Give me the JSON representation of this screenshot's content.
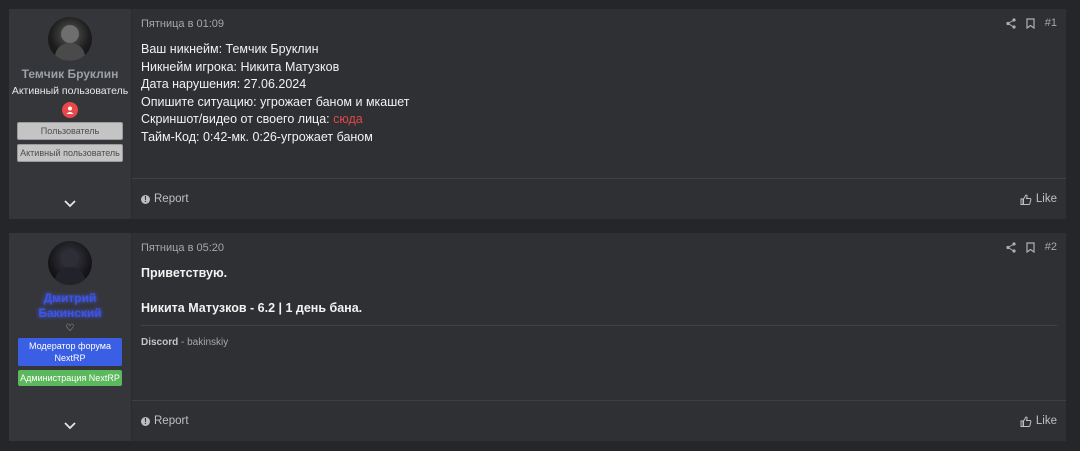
{
  "posts": [
    {
      "user": {
        "name": "Темчик Бруклин",
        "title": "Активный пользователь",
        "banners": [
          "Пользователь",
          "Активный пользователь"
        ],
        "trophy_icon": "user-status-icon"
      },
      "date": "Пятница в 01:09",
      "number": "#1",
      "lines": [
        "Ваш никнейм: Темчик Бруклин",
        "Никнейм игрока: Никита Матузков",
        "Дата нарушения: 27.06.2024",
        "Опишите ситуацию: угрожает баном и мкашет"
      ],
      "screenshot_label": "Скриншот/видео от своего лица: ",
      "screenshot_link": "сюда",
      "last_line": "Тайм-Код: 0:42-мк. 0:26-угрожает баном",
      "report_label": "Report",
      "like_label": "Like"
    },
    {
      "user": {
        "name": "Дмитрий Бакинский",
        "heart": "♡",
        "banners": [
          "Модератор форума NextRP",
          "Администрация NextRP"
        ]
      },
      "date": "Пятница в 05:20",
      "number": "#2",
      "greeting": "Приветствую.",
      "verdict": "Никита Матузков - 6.2 | 1 день бана.",
      "signature_label": "Discord",
      "signature_value": " - bakinskiy",
      "report_label": "Report",
      "like_label": "Like"
    }
  ],
  "colors": {
    "background": "#252629",
    "post_bg": "#2f3033",
    "user_cell_bg": "#35363a",
    "link_red": "#e04848",
    "moderator_blue": "#3a5fe5",
    "admin_green": "#5cb85c"
  }
}
